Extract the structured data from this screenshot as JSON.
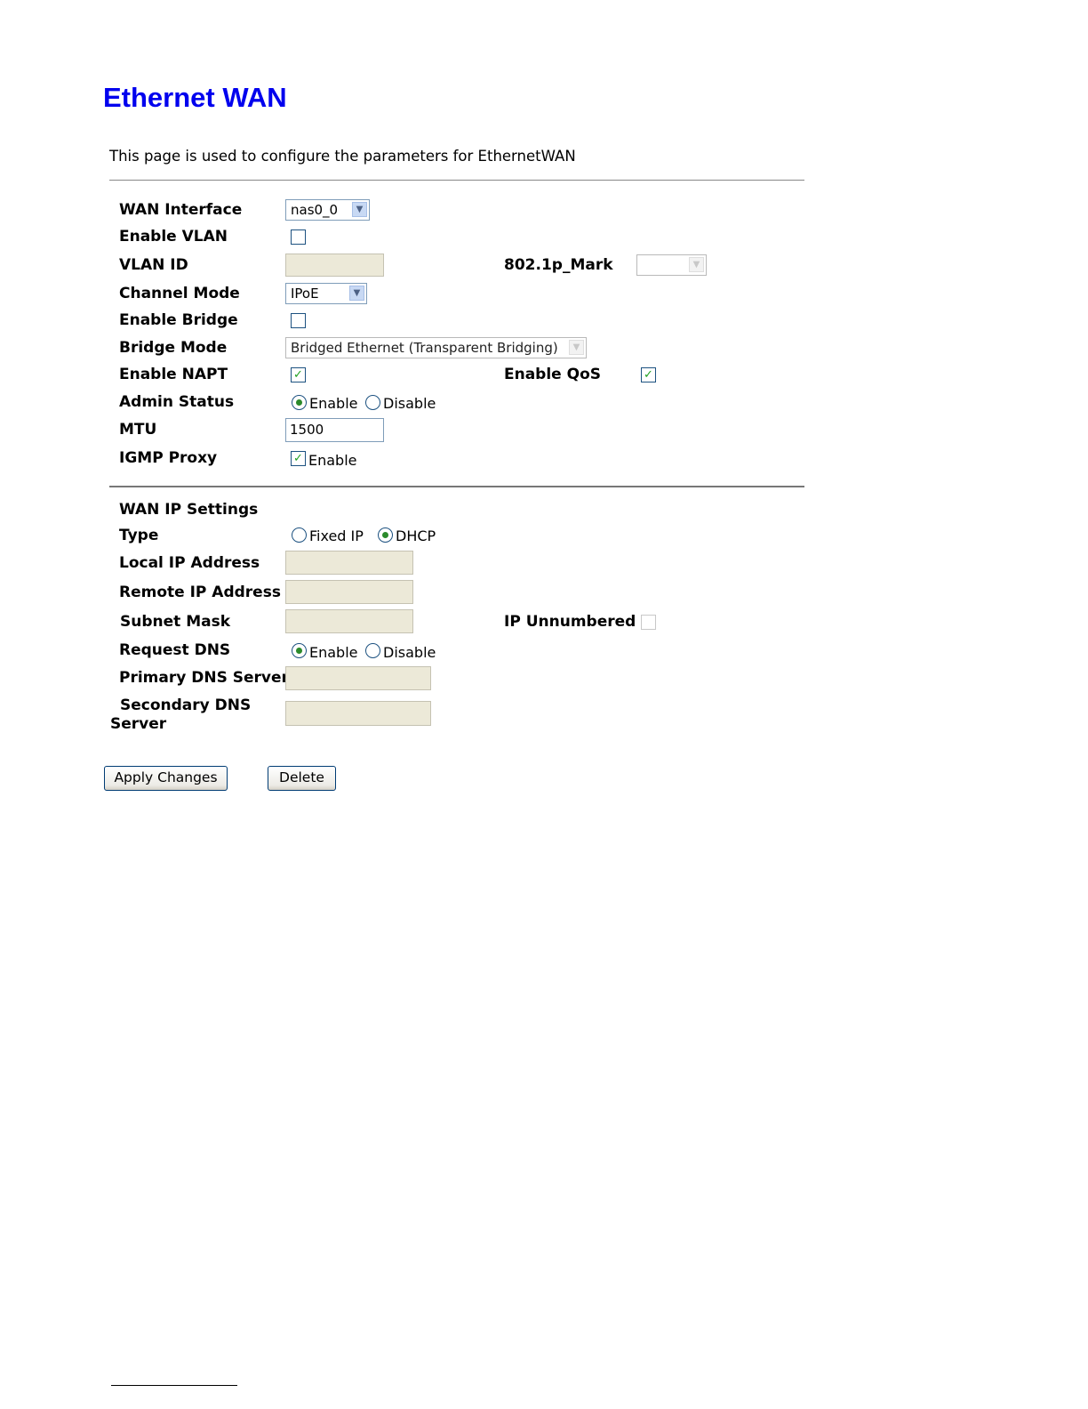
{
  "page": {
    "title": "Ethernet WAN",
    "description": "This page is used to configure the parameters for EthernetWAN"
  },
  "wan": {
    "wan_interface": {
      "label": "WAN Interface",
      "value": "nas0_0"
    },
    "enable_vlan": {
      "label": "Enable VLAN",
      "checked": false
    },
    "vlan_id": {
      "label": "VLAN ID",
      "value": ""
    },
    "mark": {
      "label": "802.1p_Mark",
      "value": ""
    },
    "channel_mode": {
      "label": "Channel Mode",
      "value": "IPoE"
    },
    "enable_bridge": {
      "label": "Enable Bridge",
      "checked": false
    },
    "bridge_mode": {
      "label": "Bridge Mode",
      "value": "Bridged Ethernet (Transparent Bridging)"
    },
    "enable_napt": {
      "label": "Enable NAPT",
      "checked": true
    },
    "enable_qos": {
      "label": "Enable QoS",
      "checked": true
    },
    "admin_status": {
      "label": "Admin Status",
      "options": [
        "Enable",
        "Disable"
      ],
      "selected": "Enable"
    },
    "mtu": {
      "label": "MTU",
      "value": "1500"
    },
    "igmp_proxy": {
      "label": "IGMP Proxy",
      "option_label": "Enable",
      "checked": true
    }
  },
  "ip_settings": {
    "heading": "WAN IP Settings",
    "type": {
      "label": "Type",
      "options": [
        "Fixed IP",
        "DHCP"
      ],
      "selected": "DHCP"
    },
    "local_ip": {
      "label": "Local IP Address",
      "value": ""
    },
    "remote_ip": {
      "label": "Remote IP Address",
      "value": ""
    },
    "subnet_mask": {
      "label": "Subnet Mask",
      "value": ""
    },
    "ip_unnumbered": {
      "label": "IP Unnumbered",
      "checked": false
    },
    "request_dns": {
      "label": "Request DNS",
      "options": [
        "Enable",
        "Disable"
      ],
      "selected": "Enable"
    },
    "primary_dns": {
      "label": "Primary DNS Server",
      "value": ""
    },
    "secondary_dns": {
      "label_line1": "Secondary DNS",
      "label_line2": "Server",
      "value": ""
    }
  },
  "buttons": {
    "apply": "Apply Changes",
    "delete": "Delete"
  },
  "icons": {
    "dropdown_arrow": "chevron-down-icon",
    "checkmark": "checkmark-icon"
  },
  "colors": {
    "title": "#0000ee",
    "disabled_input_bg": "#ece9d8",
    "check_green": "#21a121"
  }
}
